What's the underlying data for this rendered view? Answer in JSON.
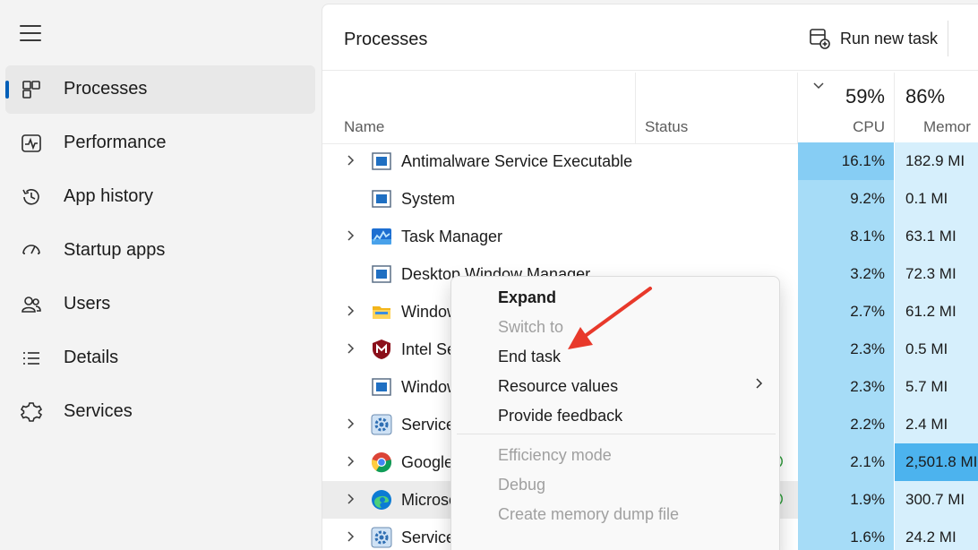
{
  "sidebar": {
    "menu_icon": "hamburger-icon",
    "items": [
      {
        "label": "Processes",
        "icon": "processes-icon",
        "active": true
      },
      {
        "label": "Performance",
        "icon": "performance-icon"
      },
      {
        "label": "App history",
        "icon": "history-icon"
      },
      {
        "label": "Startup apps",
        "icon": "startup-icon"
      },
      {
        "label": "Users",
        "icon": "users-icon"
      },
      {
        "label": "Details",
        "icon": "details-icon"
      },
      {
        "label": "Services",
        "icon": "services-icon"
      }
    ]
  },
  "header": {
    "title": "Processes",
    "run_new_task": "Run new task"
  },
  "table": {
    "columns": {
      "name": "Name",
      "status": "Status",
      "cpu_label": "CPU",
      "cpu_pct": "59%",
      "mem_label": "Memor",
      "mem_pct": "86%"
    },
    "rows": [
      {
        "name": "Antimalware Service Executable",
        "cpu": "16.1%",
        "mem": "182.9 MI",
        "icon": "defender-icon",
        "expandable": true
      },
      {
        "name": "System",
        "cpu": "9.2%",
        "mem": "0.1 MI",
        "icon": "window-app-icon",
        "expandable": false
      },
      {
        "name": "Task Manager",
        "cpu": "8.1%",
        "mem": "63.1 MI",
        "icon": "task-manager-icon",
        "expandable": true
      },
      {
        "name": "Desktop Window Manager",
        "cpu": "3.2%",
        "mem": "72.3 MI",
        "icon": "window-app-icon",
        "expandable": false
      },
      {
        "name": "Window",
        "cpu": "2.7%",
        "mem": "61.2 MI",
        "icon": "folder-icon",
        "expandable": true
      },
      {
        "name": "Intel Se",
        "cpu": "2.3%",
        "mem": "0.5 MI",
        "icon": "mcafee-shield-icon",
        "expandable": true
      },
      {
        "name": "Window",
        "cpu": "2.3%",
        "mem": "5.7 MI",
        "icon": "window-app-icon",
        "expandable": false
      },
      {
        "name": "Service",
        "cpu": "2.2%",
        "mem": "2.4 MI",
        "icon": "service-gear-icon",
        "expandable": true
      },
      {
        "name": "Google",
        "cpu": "2.1%",
        "mem": "2,501.8 MI",
        "icon": "chrome-icon",
        "expandable": true
      },
      {
        "name": "Microso",
        "cpu": "1.9%",
        "mem": "300.7 MI",
        "icon": "edge-icon",
        "expandable": true
      },
      {
        "name": "Service",
        "cpu": "1.6%",
        "mem": "24.2 MI",
        "icon": "service-gear-icon",
        "expandable": true
      }
    ]
  },
  "context_menu": {
    "items": [
      {
        "label": "Expand",
        "style": "bold"
      },
      {
        "label": "Switch to",
        "style": "disabled"
      },
      {
        "label": "End task",
        "style": "normal"
      },
      {
        "label": "Resource values",
        "style": "normal",
        "submenu": true
      },
      {
        "label": "Provide feedback",
        "style": "normal"
      },
      {
        "label": "Efficiency mode",
        "style": "disabled"
      },
      {
        "label": "Debug",
        "style": "disabled"
      },
      {
        "label": "Create memory dump file",
        "style": "disabled"
      }
    ]
  },
  "colors": {
    "accent": "#005fb8",
    "cpu_cell": "#a6dcf7",
    "mem_cell": "#d6effc",
    "mem_hot": "#4cb3ee",
    "annotation_arrow": "#e8392b"
  }
}
